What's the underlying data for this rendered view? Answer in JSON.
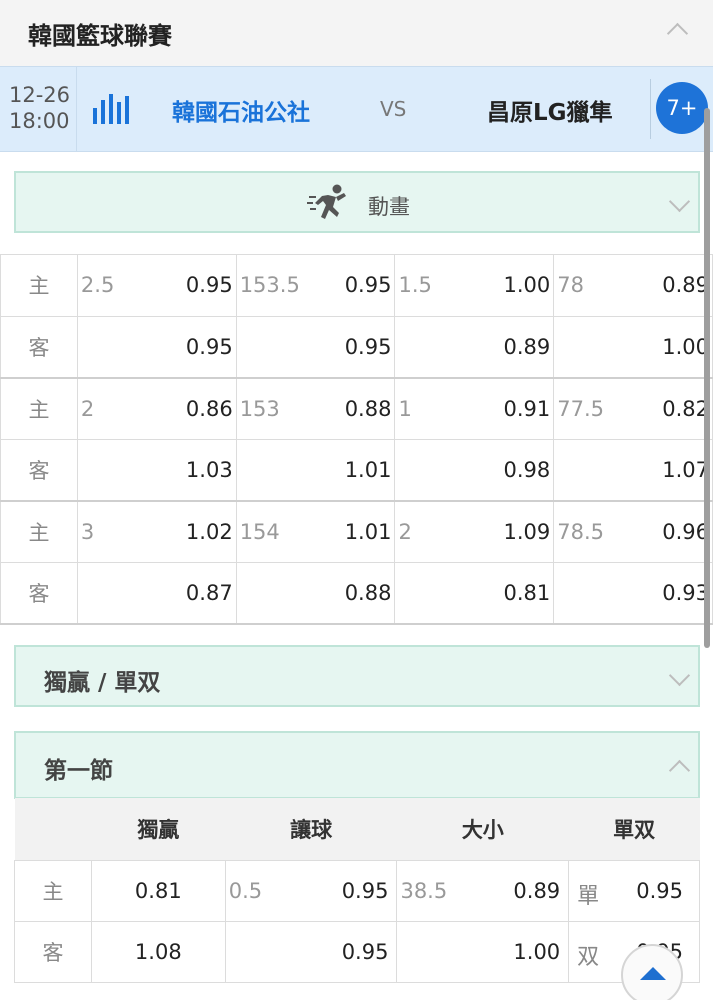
{
  "league": {
    "title": "韓國籃球聯賽"
  },
  "match": {
    "date": "12-26",
    "time": "18:00",
    "home_team": "韓國石油公社",
    "vs": "VS",
    "away_team": "昌原LG獵隼",
    "more_badge": "7+"
  },
  "animation": {
    "label": "動畫"
  },
  "odds_groups": [
    {
      "home": {
        "side": "主",
        "handicap_line": "2.5",
        "handicap_odds": "0.95",
        "total_line": "153.5",
        "total_odds": "0.95",
        "h2_line": "1.5",
        "h2_odds": "1.00",
        "t2_line": "78",
        "t2_odds": "0.89"
      },
      "away": {
        "side": "客",
        "handicap_line": "",
        "handicap_odds": "0.95",
        "total_line": "",
        "total_odds": "0.95",
        "h2_line": "",
        "h2_odds": "0.89",
        "t2_line": "",
        "t2_odds": "1.00"
      }
    },
    {
      "home": {
        "side": "主",
        "handicap_line": "2",
        "handicap_odds": "0.86",
        "total_line": "153",
        "total_odds": "0.88",
        "h2_line": "1",
        "h2_odds": "0.91",
        "t2_line": "77.5",
        "t2_odds": "0.82"
      },
      "away": {
        "side": "客",
        "handicap_line": "",
        "handicap_odds": "1.03",
        "total_line": "",
        "total_odds": "1.01",
        "h2_line": "",
        "h2_odds": "0.98",
        "t2_line": "",
        "t2_odds": "1.07"
      }
    },
    {
      "home": {
        "side": "主",
        "handicap_line": "3",
        "handicap_odds": "1.02",
        "total_line": "154",
        "total_odds": "1.01",
        "h2_line": "2",
        "h2_odds": "1.09",
        "t2_line": "78.5",
        "t2_odds": "0.96"
      },
      "away": {
        "side": "客",
        "handicap_line": "",
        "handicap_odds": "0.87",
        "total_line": "",
        "total_odds": "0.88",
        "h2_line": "",
        "h2_odds": "0.81",
        "t2_line": "",
        "t2_odds": "0.93"
      }
    }
  ],
  "section_moneyline": {
    "title": "獨贏 / 單双"
  },
  "section_q1": {
    "title": "第一節",
    "headers": [
      "",
      "獨贏",
      "讓球",
      "大小",
      "單双"
    ],
    "rows": [
      {
        "side": "主",
        "win": "0.81",
        "hdp_line": "0.5",
        "hdp_odds": "0.95",
        "ou_line": "38.5",
        "ou_odds": "0.89",
        "oe_label": "單",
        "oe_odds": "0.95"
      },
      {
        "side": "客",
        "win": "1.08",
        "hdp_line": "",
        "hdp_odds": "0.95",
        "ou_line": "",
        "ou_odds": "1.00",
        "oe_label": "双",
        "oe_odds": "0.95"
      }
    ]
  },
  "colors": {
    "accent_blue": "#1a73d9",
    "section_green": "#e6f6f1",
    "match_row_blue": "#dcecfb"
  },
  "icons": [
    "chevron-up-icon",
    "stats-bars-icon",
    "runner-icon",
    "chevron-down-icon",
    "scroll-top-arrow-icon"
  ]
}
